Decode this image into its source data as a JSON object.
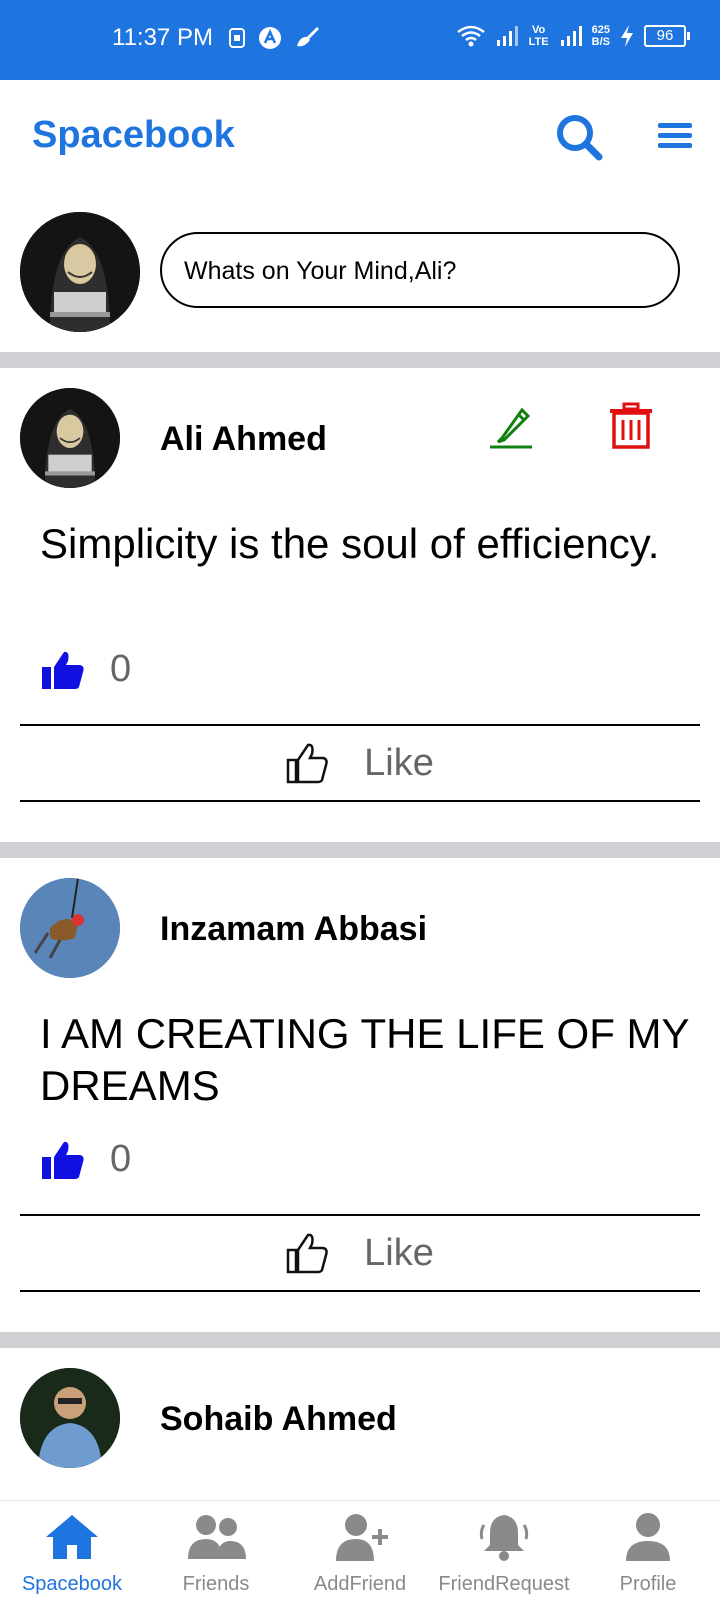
{
  "status_bar": {
    "time": "11:37 PM",
    "net_speed_value": "625",
    "net_speed_unit": "B/S",
    "volte": "Vo LTE",
    "battery": "96"
  },
  "header": {
    "title": "Spacebook",
    "icons": [
      "search-icon",
      "menu-icon"
    ]
  },
  "composer": {
    "placeholder": "Whats on Your Mind,Ali?"
  },
  "posts": [
    {
      "author": "Ali Ahmed",
      "text": "Simplicity is the soul of efficiency.",
      "likes": "0",
      "like_label": "Like",
      "editable": true
    },
    {
      "author": "Inzamam Abbasi",
      "text": "I AM CREATING THE LIFE OF MY DREAMS",
      "likes": "0",
      "like_label": "Like",
      "editable": false
    },
    {
      "author": "Sohaib Ahmed"
    }
  ],
  "bottom_nav": {
    "items": [
      {
        "label": "Spacebook",
        "icon": "home-icon",
        "active": true
      },
      {
        "label": "Friends",
        "icon": "friends-icon",
        "active": false
      },
      {
        "label": "AddFriend",
        "icon": "add-friend-icon",
        "active": false
      },
      {
        "label": "FriendRequest",
        "icon": "bell-icon",
        "active": false
      },
      {
        "label": "Profile",
        "icon": "profile-icon",
        "active": false
      }
    ]
  },
  "colors": {
    "brand": "#1f75e0",
    "edit": "#108010",
    "delete": "#e01010",
    "like_count_icon": "#1010e0",
    "divider": "#cfd0d4"
  }
}
